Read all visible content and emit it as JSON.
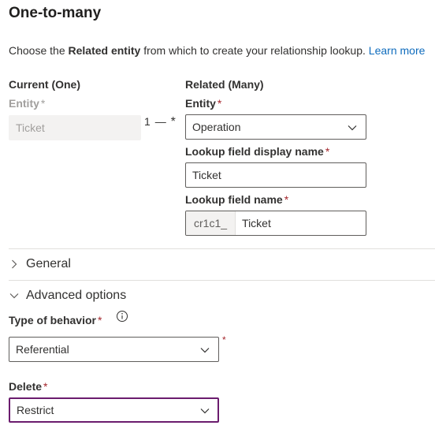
{
  "title": "One-to-many",
  "description": {
    "prefix": "Choose the ",
    "bold": "Related entity",
    "suffix": " from which to create your relationship lookup. ",
    "link": "Learn more"
  },
  "current": {
    "heading": "Current (One)",
    "entity_label": "Entity",
    "entity_value": "Ticket"
  },
  "connector": {
    "one": "1",
    "dash": "—",
    "many": "*"
  },
  "related": {
    "heading": "Related (Many)",
    "entity_label": "Entity",
    "entity_value": "Operation",
    "lookup_display_label": "Lookup field display name",
    "lookup_display_value": "Ticket",
    "lookup_name_label": "Lookup field name",
    "lookup_name_prefix": "cr1c1_",
    "lookup_name_value": "Ticket"
  },
  "required_mark": "*",
  "sections": {
    "general": "General",
    "advanced": "Advanced options"
  },
  "behavior": {
    "label": "Type of behavior",
    "value": "Referential",
    "info_icon": "info-icon"
  },
  "delete": {
    "label": "Delete",
    "value": "Restrict"
  },
  "colors": {
    "link": "#0f6cbd",
    "required": "#a4262c",
    "focus_border": "#6b1c6e"
  }
}
